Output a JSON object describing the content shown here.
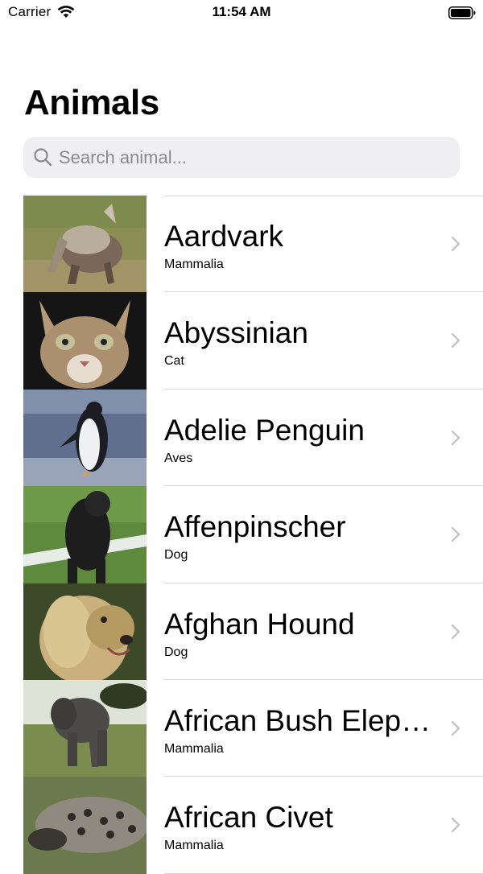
{
  "status_bar": {
    "carrier": "Carrier",
    "time": "11:54 AM",
    "wifi_icon": "wifi-icon",
    "battery_icon": "battery-icon"
  },
  "title": "Animals",
  "search": {
    "placeholder": "Search animal...",
    "value": "",
    "icon": "search-icon"
  },
  "animals": [
    {
      "name": "Aardvark",
      "class": "Mammalia",
      "image": "aardvark-photo"
    },
    {
      "name": "Abyssinian",
      "class": "Cat",
      "image": "abyssinian-cat-photo"
    },
    {
      "name": "Adelie Penguin",
      "class": "Aves",
      "image": "adelie-penguin-photo"
    },
    {
      "name": "Affenpinscher",
      "class": "Dog",
      "image": "affenpinscher-dog-photo"
    },
    {
      "name": "Afghan Hound",
      "class": "Dog",
      "image": "afghan-hound-photo"
    },
    {
      "name": "African Bush Elephant",
      "class": "Mammalia",
      "image": "african-bush-elephant-photo"
    },
    {
      "name": "African Civet",
      "class": "Mammalia",
      "image": "african-civet-photo"
    }
  ],
  "colors": {
    "search_background": "#efeff1",
    "placeholder": "#8a8a8e",
    "separator": "#d6d6da",
    "chevron": "#c4c4c7"
  }
}
